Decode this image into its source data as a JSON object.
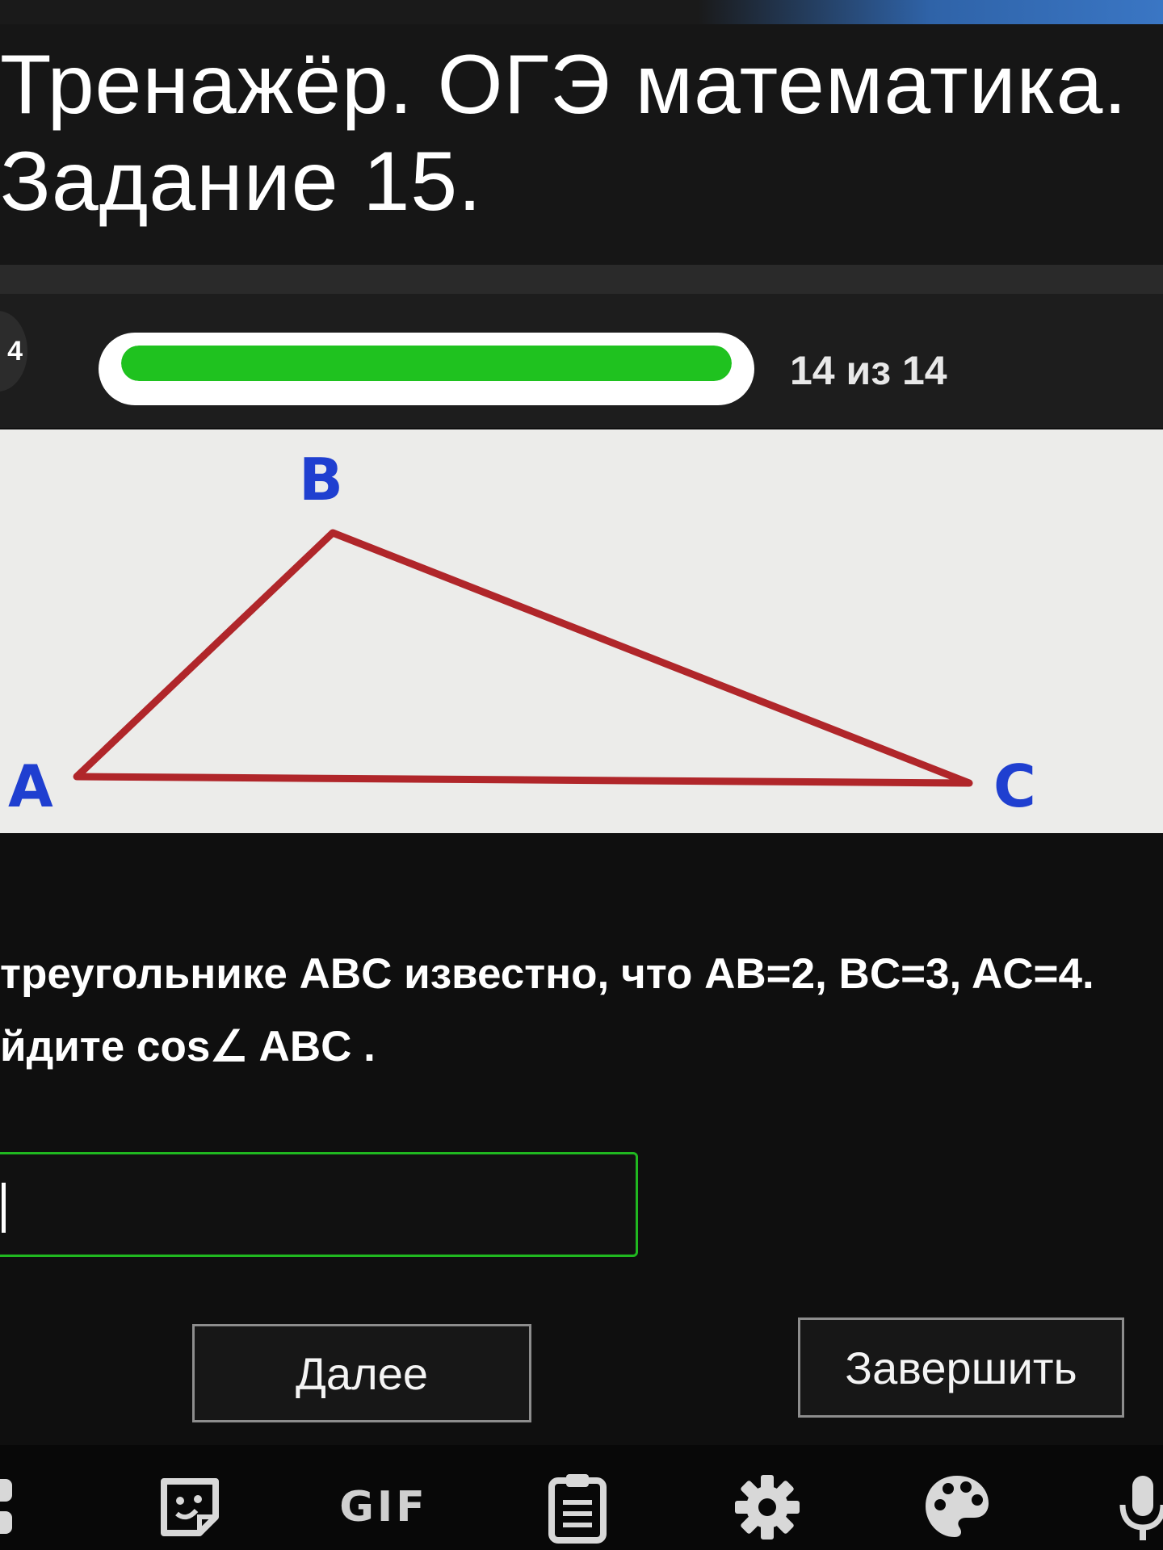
{
  "header": {
    "title_line1": "Тренажёр. ОГЭ математика.",
    "title_line2": "Задание 15."
  },
  "progress": {
    "prev_label": "4",
    "text": "14 из 14",
    "fraction": 1.0,
    "fill_color": "#1fc21f"
  },
  "figure": {
    "vertices": {
      "A": "A",
      "B": "B",
      "C": "C"
    },
    "line_color": "#b0262a",
    "label_color": "#1f3fd0"
  },
  "question": {
    "line1": "треугольнике ABC известно, что AB=2, BC=3, AC=4.",
    "line2": "йдите cos∠ ABC  ."
  },
  "answer": {
    "value": "",
    "placeholder": ""
  },
  "buttons": {
    "next": "Далее",
    "finish": "Завершить"
  },
  "keyboard_toolbar": {
    "icons": [
      "apps-icon",
      "sticker-icon",
      "gif-icon",
      "clipboard-icon",
      "settings-icon",
      "palette-icon",
      "microphone-icon"
    ],
    "gif_label": "GIF"
  }
}
